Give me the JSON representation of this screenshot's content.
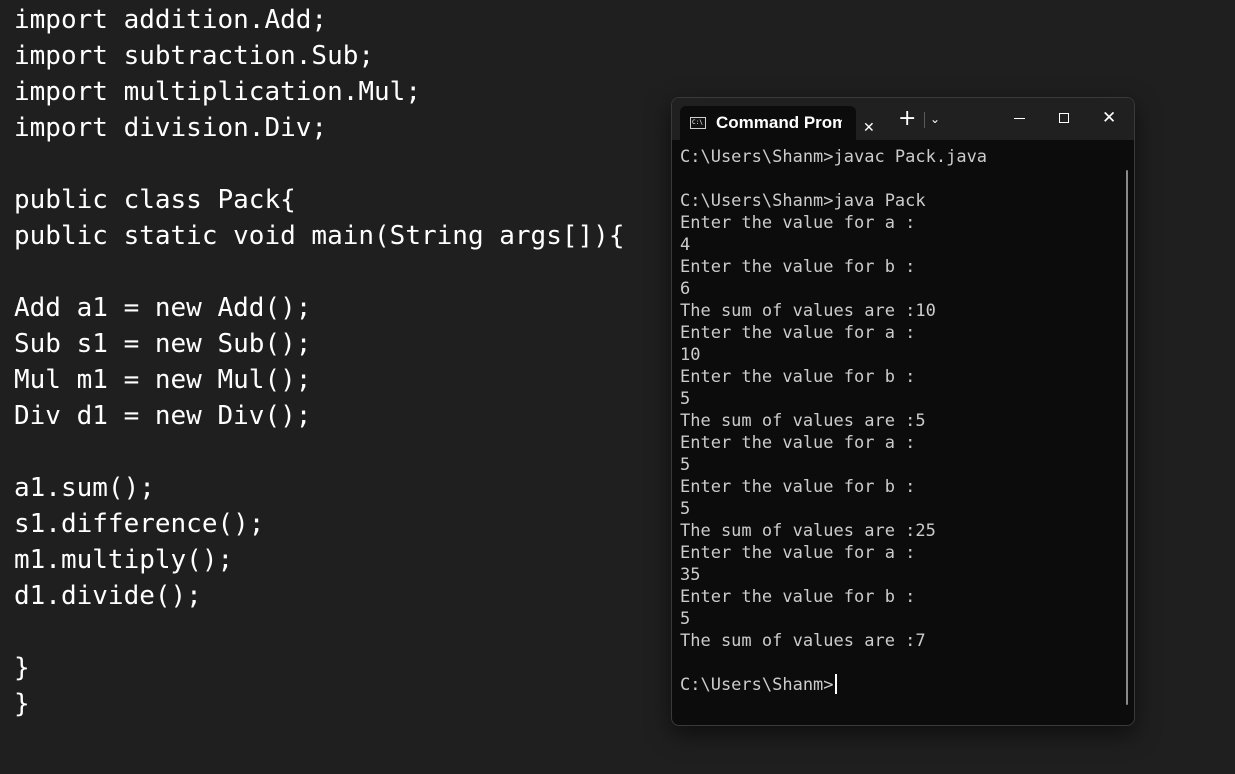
{
  "editor": {
    "lines": [
      "import addition.Add;",
      "import subtraction.Sub;",
      "import multiplication.Mul;",
      "import division.Div;",
      "",
      "public class Pack{",
      "public static void main(String args[]){",
      "",
      "Add a1 = new Add();",
      "Sub s1 = new Sub();",
      "Mul m1 = new Mul();",
      "Div d1 = new Div();",
      "",
      "a1.sum();",
      "s1.difference();",
      "m1.multiply();",
      "d1.divide();",
      "",
      "}",
      "}"
    ]
  },
  "window": {
    "tab_icon_label": "C:\\",
    "tab_title": "Command Prompt",
    "tab_close_icon": "close-icon",
    "new_tab_symbol": "+",
    "dropdown_symbol": "⌄",
    "minimize_icon": "minimize-icon",
    "maximize_icon": "maximize-icon",
    "close_icon": "close-icon",
    "close_symbol": "✕"
  },
  "terminal": {
    "lines": [
      "C:\\Users\\Shanm>javac Pack.java",
      "",
      "C:\\Users\\Shanm>java Pack",
      "Enter the value for a :",
      "4",
      "Enter the value for b :",
      "6",
      "The sum of values are :10",
      "Enter the value for a :",
      "10",
      "Enter the value for b :",
      "5",
      "The sum of values are :5",
      "Enter the value for a :",
      "5",
      "Enter the value for b :",
      "5",
      "The sum of values are :25",
      "Enter the value for a :",
      "35",
      "Enter the value for b :",
      "5",
      "The sum of values are :7",
      "",
      "C:\\Users\\Shanm>"
    ]
  }
}
